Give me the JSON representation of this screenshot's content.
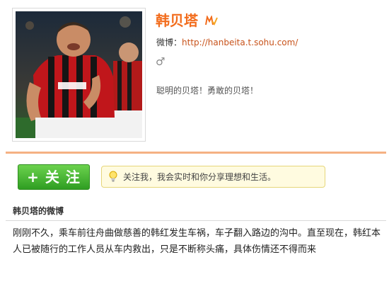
{
  "profile": {
    "name": "韩贝塔",
    "verified_icon": "sohu-verified-icon",
    "weibo_label": "微博：",
    "weibo_url": "http://hanbeita.t.sohu.com/",
    "gender_icon": "male-icon",
    "gender_symbol": "♂",
    "bio": "聪明的贝塔！勇敢的贝塔！"
  },
  "follow": {
    "button_label": "+ 关 注",
    "tip_icon": "lightbulb-icon",
    "tip_text": "关注我，我会实时和你分享理想和生活。"
  },
  "feed": {
    "section_title": "韩贝塔的微博",
    "posts": [
      {
        "text": "刚刚不久，乘车前往舟曲做慈善的韩红发生车祸，车子翻入路边的沟中。直至现在，韩红本人已被随行的工作人员从车内救出，只是不断称头痛，具体伤情还不得而来"
      }
    ]
  },
  "colors": {
    "accent": "#f26c1c",
    "link": "#c8531b",
    "follow_green": "#3aa82a",
    "divider_orange": "#f5b183",
    "tip_background": "#fffbe0"
  }
}
